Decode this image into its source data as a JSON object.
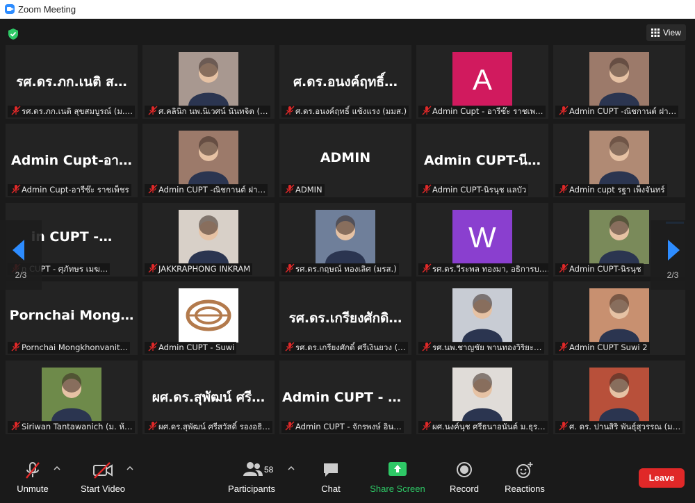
{
  "window": {
    "title": "Zoom Meeting"
  },
  "view_button": {
    "label": "View"
  },
  "pagination": {
    "left_page": "2/3",
    "right_page": "2/3"
  },
  "tiles": [
    {
      "name": "รศ.ดร.ภก.เนติ สุขสมบูรณ์ (ม.…",
      "display": "รศ.ดร.ภก.เนติ ส…",
      "type": "text"
    },
    {
      "name": "ศ.คลินิก นพ.นิเวศน์ นันทจิต (…",
      "type": "photo",
      "color": "#a89890"
    },
    {
      "name": "ศ.ดร.อนงค์ฤทธิ์ แซ้งแรง (มมส.)",
      "display": "ศ.ดร.อนงค์ฤทธิ์…",
      "type": "text"
    },
    {
      "name": "Admin Cupt - อารีซ๊ะ ราชเพ…",
      "type": "letter",
      "letter": "A",
      "color": "#d11a5e"
    },
    {
      "name": "Admin CUPT -ณิชกานต์ ฝา…",
      "type": "photo",
      "color": "#9c7a6a"
    },
    {
      "name": "Admin Cupt-อารีซ๊ะ ราชเพ็ชร",
      "display": "Admin Cupt-อา…",
      "type": "text"
    },
    {
      "name": "Admin CUPT -ณิชกานต์ ฝา…",
      "type": "photo",
      "color": "#9c7a6a"
    },
    {
      "name": "ADMIN",
      "display": "ADMIN",
      "type": "text"
    },
    {
      "name": "Admin CUPT-นิรนุช แลบัว",
      "display": "Admin CUPT-นี…",
      "type": "text"
    },
    {
      "name": "Admin cupt รฐา เพ็งจันทร์",
      "type": "photo",
      "color": "#b08a74"
    },
    {
      "name": "n CUPT - ศุภัทษร เมฆ…",
      "display": "in CUPT -…",
      "type": "text"
    },
    {
      "name": "JAKKRAPHONG INKRAM",
      "type": "photo",
      "color": "#d8d0c8"
    },
    {
      "name": "รศ.ดร.กฤษณ์ ทองเลิศ (มรส.)",
      "type": "photo",
      "color": "#6f7f9a"
    },
    {
      "name": "รศ.ดร.วีระพล ทองมา, อธิการบ…",
      "type": "letter",
      "letter": "W",
      "color": "#8a3fcf"
    },
    {
      "name": "Admin CUPT-นิรนุช",
      "type": "photo",
      "color": "#7a8a5a"
    },
    {
      "name": "Pornchai Mongkhonvanit…",
      "display": "Pornchai Mong…",
      "type": "text"
    },
    {
      "name": "Admin CUPT - Suwi",
      "type": "logo",
      "color": "#ffffff"
    },
    {
      "name": "รศ.ดร.เกรียงศักดิ์ ศรีเงินยวง (…",
      "display": "รศ.ดร.เกรียงศักดิ…",
      "type": "text"
    },
    {
      "name": "รศ.นพ.ชาญชัย พานทองวิริยะ…",
      "type": "photo",
      "color": "#c8ccd4"
    },
    {
      "name": "Admin CUPT Suwi 2",
      "type": "photo",
      "color": "#c89070"
    },
    {
      "name": "Siriwan Tantawanich (ม. ห้…",
      "type": "photo",
      "color": "#6e8a4a"
    },
    {
      "name": "ผศ.ดร.สุพัฒน์ ศรีสวัสดิ์ รองอธิ…",
      "display": "ผศ.ดร.สุพัฒน์ ศรี…",
      "type": "text"
    },
    {
      "name": "Admin CUPT - จักรพงษ์ อิน…",
      "display": "Admin CUPT - จั…",
      "type": "text"
    },
    {
      "name": "ผศ.นงค์นุช ศรีธนาอนันต์ ม.ธุร…",
      "type": "photo",
      "color": "#e0dcd8"
    },
    {
      "name": "ศ. ดร. ปานสิริ พันธุ์สุวรรณ (ม…",
      "type": "photo",
      "color": "#b8503a"
    }
  ],
  "toolbar": {
    "unmute": "Unmute",
    "start_video": "Start Video",
    "participants": "Participants",
    "participants_count": "58",
    "chat": "Chat",
    "share_screen": "Share Screen",
    "record": "Record",
    "reactions": "Reactions",
    "leave": "Leave"
  },
  "colors": {
    "share_green": "#2ec866",
    "leave_red": "#e02828",
    "muted_red": "#e02828",
    "nav_blue": "#2d8cff"
  }
}
